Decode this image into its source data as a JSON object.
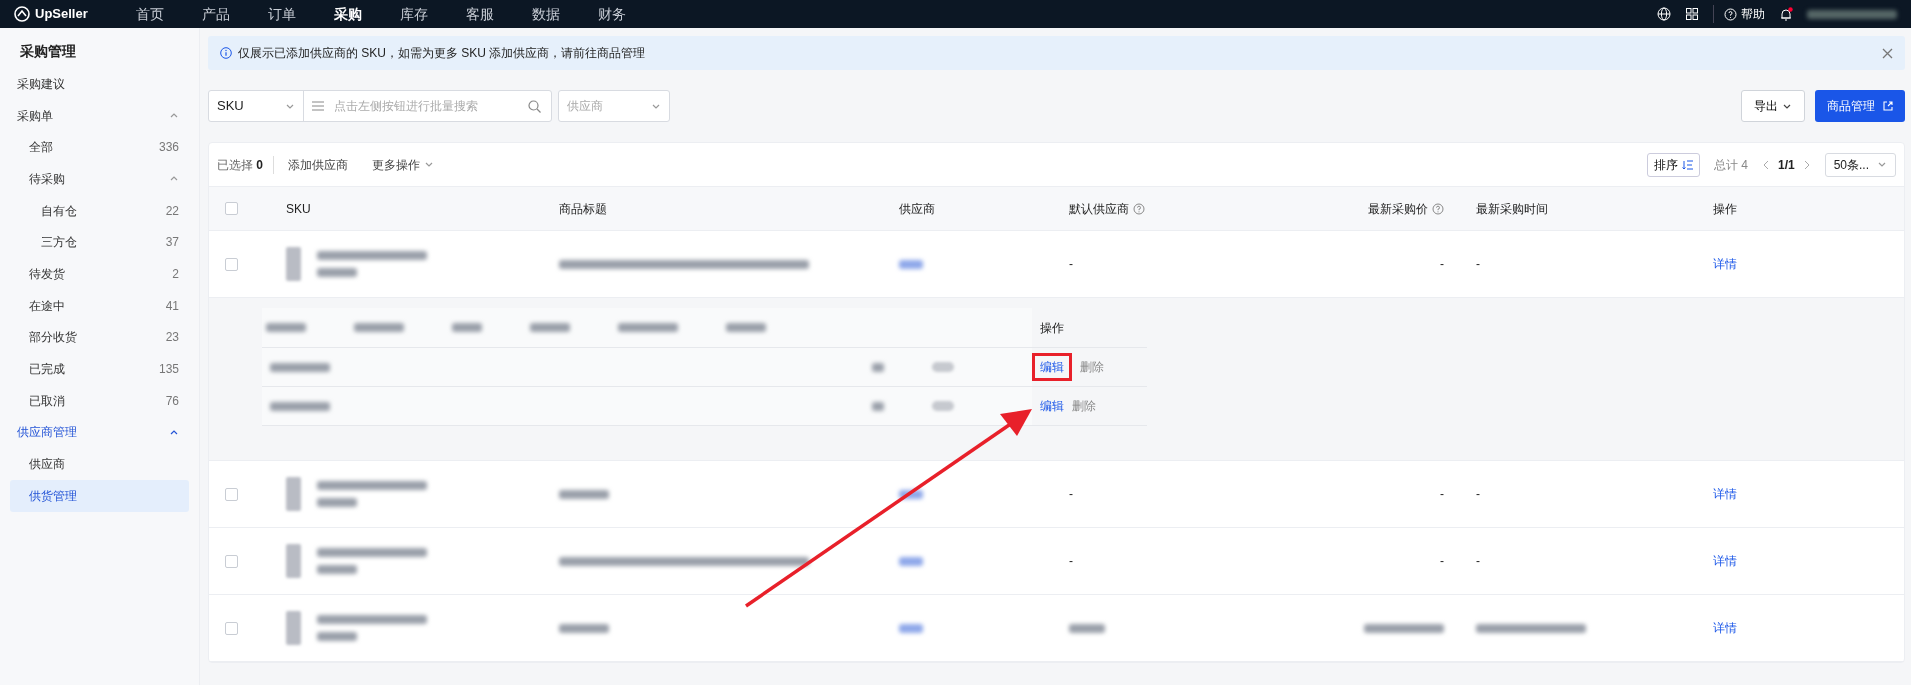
{
  "topbar": {
    "brand": "UpSeller",
    "nav": [
      {
        "label": "首页",
        "selected": false
      },
      {
        "label": "产品",
        "selected": false
      },
      {
        "label": "订单",
        "selected": false
      },
      {
        "label": "采购",
        "selected": true
      },
      {
        "label": "库存",
        "selected": false
      },
      {
        "label": "客服",
        "selected": false
      },
      {
        "label": "数据",
        "selected": false
      },
      {
        "label": "财务",
        "selected": false
      }
    ],
    "help": "帮助"
  },
  "sidebar": {
    "title": "采购管理",
    "items": [
      {
        "label": "采购建议",
        "selected": false
      },
      {
        "label": "采购单",
        "selected": false,
        "expanded": true,
        "children": [
          {
            "label": "全部",
            "count": "336",
            "selected": false
          },
          {
            "label": "待采购",
            "selected": false,
            "expanded": true,
            "children": [
              {
                "label": "自有仓",
                "count": "22",
                "selected": false
              },
              {
                "label": "三方仓",
                "count": "37",
                "selected": false
              }
            ]
          },
          {
            "label": "待发货",
            "count": "2",
            "selected": false
          },
          {
            "label": "在途中",
            "count": "41",
            "selected": false
          },
          {
            "label": "部分收货",
            "count": "23",
            "selected": false
          },
          {
            "label": "已完成",
            "count": "135",
            "selected": false
          },
          {
            "label": "已取消",
            "count": "76",
            "selected": false
          }
        ]
      },
      {
        "label": "供应商管理",
        "selected": false,
        "expanded": true,
        "children": [
          {
            "label": "供应商",
            "selected": false
          },
          {
            "label": "供货管理",
            "selected": true
          }
        ]
      }
    ]
  },
  "notice": {
    "text": "仅展示已添加供应商的 SKU，如需为更多 SKU 添加供应商，请前往商品管理"
  },
  "filters": {
    "search_type": "SKU",
    "search_placeholder": "点击左侧按钮进行批量搜索",
    "supplier_placeholder": "供应商",
    "export": "导出",
    "product_management": "商品管理"
  },
  "table_toolbar": {
    "selected_label": "已选择",
    "selected_count": "0",
    "add_supplier": "添加供应商",
    "more_actions": "更多操作",
    "sort": "排序",
    "total": "总计 4",
    "page": "1/1",
    "page_size": "50条..."
  },
  "table": {
    "select_all_checked": false,
    "columns": [
      {
        "label": "SKU",
        "help": false
      },
      {
        "label": "商品标题",
        "help": false
      },
      {
        "label": "供应商",
        "help": false
      },
      {
        "label": "默认供应商",
        "help": true
      },
      {
        "label": "最新采购价",
        "help": true
      },
      {
        "label": "最新采购时间",
        "help": false
      },
      {
        "label": "操作",
        "help": false
      }
    ],
    "rows": [
      {
        "checked": false,
        "default_supplier": "-",
        "latest_price": "-",
        "latest_time": "-",
        "action": "详情",
        "detail": {
          "action_header": "操作",
          "rows": [
            {
              "edit": "编辑",
              "delete": "删除",
              "highlighted": true,
              "on": false
            },
            {
              "edit": "编辑",
              "delete": "删除",
              "highlighted": false,
              "on": false
            }
          ]
        }
      },
      {
        "checked": false,
        "default_supplier": "-",
        "latest_price": "-",
        "latest_time": "-",
        "action": "详情"
      },
      {
        "checked": false,
        "default_supplier": "-",
        "latest_price": "-",
        "latest_time": "-",
        "action": "详情"
      },
      {
        "checked": false,
        "action": "详情"
      }
    ]
  }
}
